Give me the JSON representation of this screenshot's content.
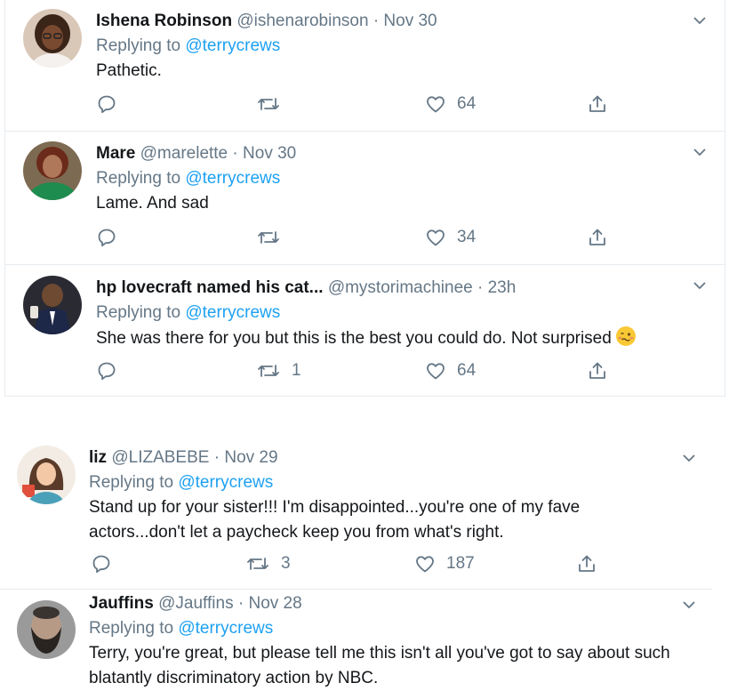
{
  "tweets": [
    {
      "name": "Ishena Robinson",
      "handle": "@ishenarobinson",
      "sep": "·",
      "time": "Nov 30",
      "replying_prefix": "Replying to",
      "replying_to": "@terrycrews",
      "text": "Pathetic.",
      "replies": "",
      "retweets": "",
      "likes": "64",
      "avatar_icon": "avatar-woman-glasses"
    },
    {
      "name": "Mare",
      "handle": "@marelette",
      "sep": "·",
      "time": "Nov 30",
      "replying_prefix": "Replying to",
      "replying_to": "@terrycrews",
      "text": "Lame. And sad",
      "replies": "",
      "retweets": "",
      "likes": "34",
      "avatar_icon": "avatar-woman-green"
    },
    {
      "name": "hp lovecraft named his cat...",
      "handle": "@mystorimachinee",
      "sep": "·",
      "time": "23h",
      "replying_prefix": "Replying to",
      "replying_to": "@terrycrews",
      "text": "She was there for you but this is the best you could do. Not surprised",
      "emoji": "woozy-face-emoji",
      "replies": "",
      "retweets": "1",
      "likes": "64",
      "avatar_icon": "avatar-man-suit"
    },
    {
      "name": "liz",
      "handle": "@LIZABEBE",
      "sep": "·",
      "time": "Nov 29",
      "replying_prefix": "Replying to",
      "replying_to": "@terrycrews",
      "text": "Stand up for your sister!!! I'm disappointed...you're one of my fave actors...don't let a paycheck keep you from what's right.",
      "replies": "",
      "retweets": "3",
      "likes": "187",
      "avatar_icon": "avatar-cartoon-woman"
    },
    {
      "name": "Jauffins",
      "handle": "@Jauffins",
      "sep": "·",
      "time": "Nov 28",
      "replying_prefix": "Replying to",
      "replying_to": "@terrycrews",
      "text": "Terry, you're great, but please tell me this isn't all you've got to say about such blatantly discriminatory action by NBC.",
      "avatar_icon": "avatar-bearded-man"
    }
  ],
  "colors": {
    "text": "#14171a",
    "muted": "#657786",
    "link": "#1da1f2",
    "border": "#e6ecf0"
  },
  "icons": {
    "reply": "reply-icon",
    "retweet": "retweet-icon",
    "like": "heart-icon",
    "share": "share-icon",
    "more": "chevron-down-icon"
  }
}
